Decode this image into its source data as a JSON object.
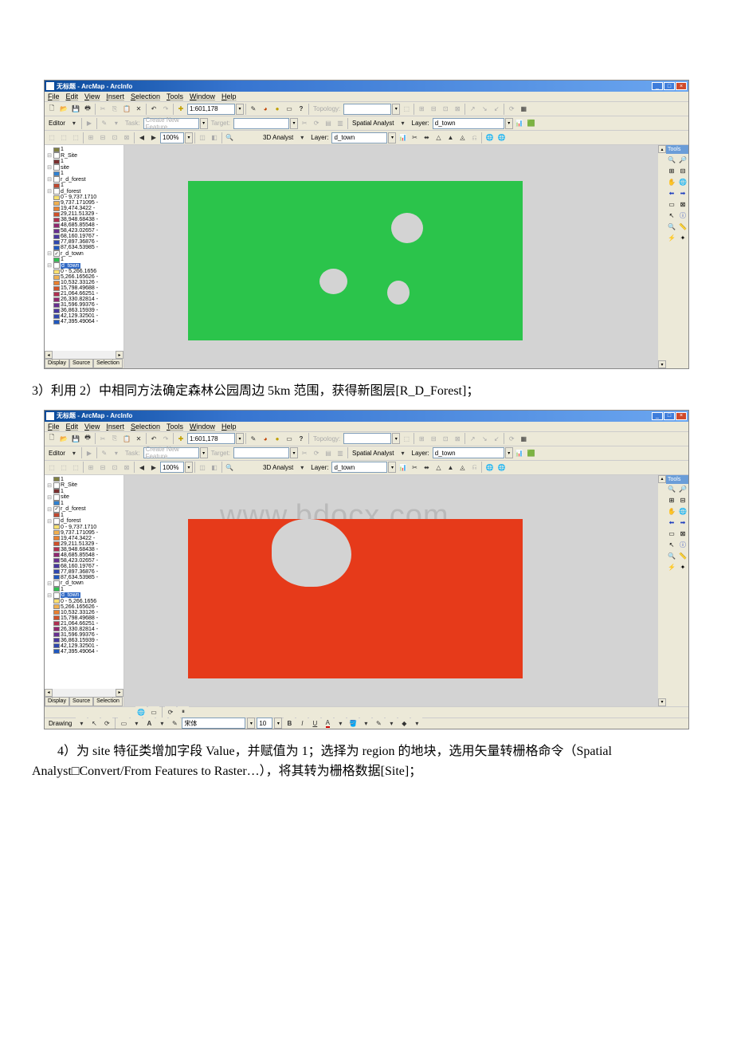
{
  "screenshots": {
    "top": {
      "title": "无标题 - ArcMap - ArcInfo",
      "menu": [
        "File",
        "Edit",
        "View",
        "Insert",
        "Selection",
        "Tools",
        "Window",
        "Help"
      ],
      "scale": "1:601,178",
      "editor_label": "Editor",
      "task_label": "Task:",
      "task_value": "Create New Feature",
      "target_label": "Target:",
      "spatial_label": "Spatial Analyst",
      "layer_label": "Layer:",
      "layer_value": "d_town",
      "analyst3d_label": "3D Analyst",
      "layer2_label": "Layer:",
      "layer2_value": "d_town",
      "topology_label": "Topology:",
      "zoom_value": "100%",
      "tools_title": "Tools",
      "toc": {
        "layers": [
          {
            "sw": "#808040",
            "label": "1"
          },
          {
            "check": false,
            "label": "R_Site"
          },
          {
            "sw": "#7a3030",
            "label": "1"
          },
          {
            "check": false,
            "label": "site"
          },
          {
            "sw": "#3080d0",
            "label": "1"
          },
          {
            "check": false,
            "label": "r_d_forest"
          },
          {
            "sw": "#c04830",
            "label": "1"
          },
          {
            "check": false,
            "label": "d_forest"
          },
          {
            "sw": "#f6e070",
            "label": "0 - 9,737.1710"
          },
          {
            "sw": "#f0b050",
            "label": "9,737.171095 -"
          },
          {
            "sw": "#e88030",
            "label": "19,474.3422 -"
          },
          {
            "sw": "#d05028",
            "label": "29,211.51329 -"
          },
          {
            "sw": "#b03050",
            "label": "38,948.68438 -"
          },
          {
            "sw": "#902870",
            "label": "48,685.85548 -"
          },
          {
            "sw": "#683090",
            "label": "58,423.02657 -"
          },
          {
            "sw": "#4838a0",
            "label": "68,160.19767 -"
          },
          {
            "sw": "#3048b0",
            "label": "77,897.36876 -"
          },
          {
            "sw": "#2058c0",
            "label": "87,634.53985 -"
          },
          {
            "check": true,
            "label": "r_d_town"
          },
          {
            "sw": "#30c050",
            "label": "1"
          },
          {
            "check": false,
            "sel": true,
            "label": "d_town"
          },
          {
            "sw": "#ffe070",
            "label": "0 - 5,266.1656"
          },
          {
            "sw": "#f0b050",
            "label": "5,266.165626 -"
          },
          {
            "sw": "#e88030",
            "label": "10,532.33126 -"
          },
          {
            "sw": "#d05028",
            "label": "15,798.49688 -"
          },
          {
            "sw": "#b03050",
            "label": "21,064.66251 -"
          },
          {
            "sw": "#902870",
            "label": "26,330.82814 -"
          },
          {
            "sw": "#683090",
            "label": "31,596.99376 -"
          },
          {
            "sw": "#4838a0",
            "label": "36,863.15939 -"
          },
          {
            "sw": "#3048b0",
            "label": "42,129.32501 -"
          },
          {
            "sw": "#2058c0",
            "label": "47,395.49064 -"
          }
        ],
        "tabs": [
          "Display",
          "Source",
          "Selection"
        ]
      }
    },
    "bottom": {
      "title": "无标题 - ArcMap - ArcInfo",
      "menu": [
        "File",
        "Edit",
        "View",
        "Insert",
        "Selection",
        "Tools",
        "Window",
        "Help"
      ],
      "scale": "1:601,178",
      "editor_label": "Editor",
      "task_label": "Task:",
      "task_value": "Create New Feature",
      "target_label": "Target:",
      "spatial_label": "Spatial Analyst",
      "layer_label": "Layer:",
      "layer_value": "d_town",
      "analyst3d_label": "3D Analyst",
      "layer2_label": "Layer:",
      "layer2_value": "d_town",
      "topology_label": "Topology:",
      "zoom_value": "100%",
      "tools_title": "Tools",
      "drawing_label": "Drawing",
      "font_value": "宋体",
      "font_size": "10",
      "watermark": "www.bdocx.com",
      "toc": {
        "layers": [
          {
            "sw": "#808040",
            "label": "1"
          },
          {
            "check": false,
            "label": "R_Site"
          },
          {
            "sw": "#7a3030",
            "label": "1"
          },
          {
            "check": false,
            "label": "site"
          },
          {
            "sw": "#3080d0",
            "label": "1"
          },
          {
            "check": true,
            "label": "r_d_forest"
          },
          {
            "sw": "#c04830",
            "label": "1"
          },
          {
            "check": false,
            "label": "d_forest"
          },
          {
            "sw": "#f6e070",
            "label": "0 - 9,737.1710"
          },
          {
            "sw": "#f0b050",
            "label": "9,737.171095 -"
          },
          {
            "sw": "#e88030",
            "label": "19,474.3422 -"
          },
          {
            "sw": "#d05028",
            "label": "29,211.51329 -"
          },
          {
            "sw": "#b03050",
            "label": "38,948.68438 -"
          },
          {
            "sw": "#902870",
            "label": "48,685.85548 -"
          },
          {
            "sw": "#683090",
            "label": "58,423.02657 -"
          },
          {
            "sw": "#4838a0",
            "label": "68,160.19767 -"
          },
          {
            "sw": "#3048b0",
            "label": "77,897.36876 -"
          },
          {
            "sw": "#2058c0",
            "label": "87,634.53985 -"
          },
          {
            "check": false,
            "label": "r_d_town"
          },
          {
            "sw": "#30c050",
            "label": "1"
          },
          {
            "check": false,
            "sel": true,
            "label": "d_town"
          },
          {
            "sw": "#ffe070",
            "label": "0 - 5,266.1656"
          },
          {
            "sw": "#f0b050",
            "label": "5,266.165626 -"
          },
          {
            "sw": "#e88030",
            "label": "10,532.33126 -"
          },
          {
            "sw": "#d05028",
            "label": "15,798.49688 -"
          },
          {
            "sw": "#b03050",
            "label": "21,064.66251 -"
          },
          {
            "sw": "#902870",
            "label": "26,330.82814 -"
          },
          {
            "sw": "#683090",
            "label": "31,596.99376 -"
          },
          {
            "sw": "#4838a0",
            "label": "36,863.15939 -"
          },
          {
            "sw": "#3048b0",
            "label": "42,129.32501 -"
          },
          {
            "sw": "#2058c0",
            "label": "47,395.49064 -"
          }
        ],
        "tabs": [
          "Display",
          "Source",
          "Selection"
        ]
      }
    }
  },
  "paragraphs": {
    "p1": "3）利用 2）中相同方法确定森林公园周边 5km 范围，获得新图层[R_D_Forest]；",
    "p2_a": "4）为 site 特征类增加字段 Value，并赋值为 1；选择为 region 的地块，选用矢量转栅格命令（Spatial Analyst",
    "p2_b": "Convert/From Features to Raster…），将其转为栅格数据[Site]；"
  }
}
